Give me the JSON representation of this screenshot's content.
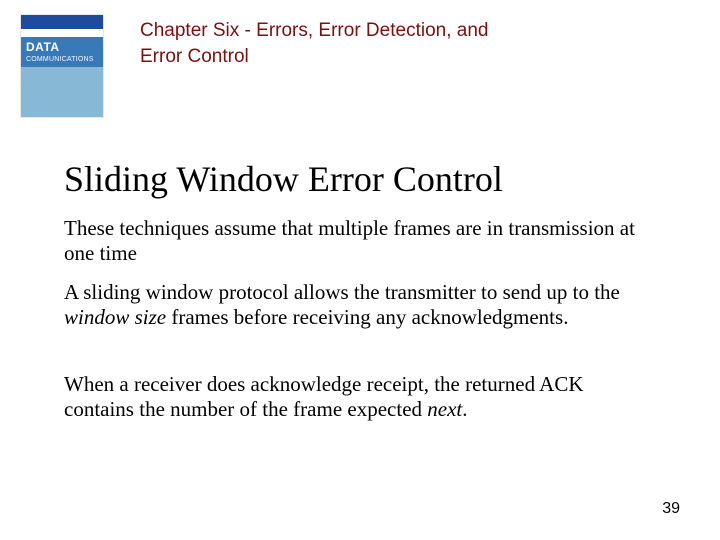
{
  "header": {
    "cover": {
      "line1": "DATA",
      "line2": "COMMUNICATIONS"
    },
    "chapter_label": "Chapter Six - Errors, Error Detection, and Error Control"
  },
  "heading": "Sliding Window Error Control",
  "paragraphs": {
    "p1": "These techniques assume that multiple frames are in transmission at one time",
    "p2_a": "A sliding window protocol allows the transmitter to send up to the ",
    "p2_i": "window size",
    "p2_b": " frames before receiving any acknowledgments.",
    "p3_a": "When a receiver does acknowledge receipt, the returned ACK contains the number of the frame expected ",
    "p3_i": "next",
    "p3_b": "."
  },
  "page_number": "39"
}
